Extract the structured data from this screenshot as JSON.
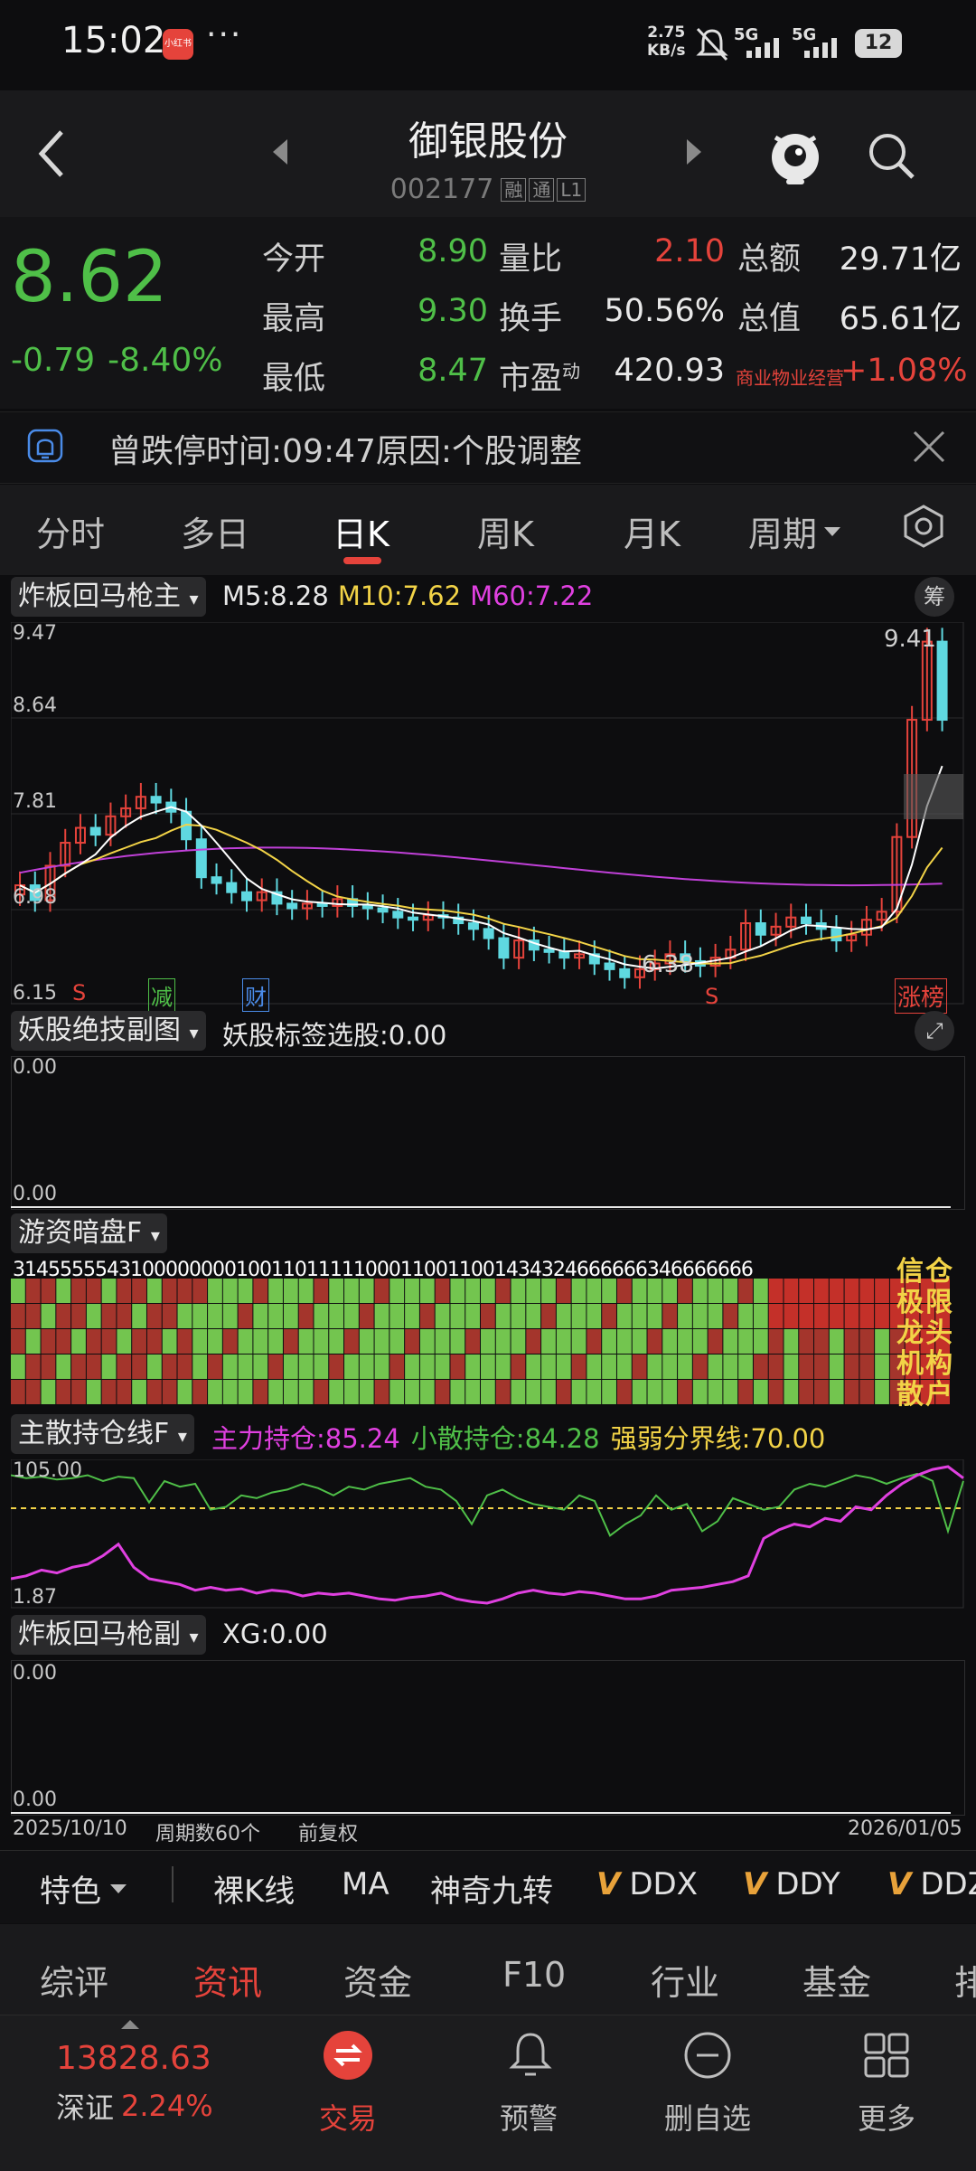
{
  "status": {
    "time": "15:02",
    "app_badge": "小红书",
    "dots": "···",
    "net_speed_value": "2.75",
    "net_speed_unit": "KB/s",
    "sig1": "5G",
    "sig2": "5G",
    "battery": "12"
  },
  "header": {
    "name": "御银股份",
    "code": "002177",
    "tags": [
      "融",
      "通",
      "L1"
    ]
  },
  "quote": {
    "price": "8.62",
    "change": "-0.79",
    "change_pct": "-8.40%",
    "rows": [
      {
        "l1": "今开",
        "v1": "8.90",
        "l2": "量比",
        "v2": "2.10",
        "l3": "总额",
        "v3": "29.71亿"
      },
      {
        "l1": "最高",
        "v1": "9.30",
        "l2": "换手",
        "v2": "50.56%",
        "l3": "总值",
        "v3": "65.61亿"
      },
      {
        "l1": "最低",
        "v1": "8.47",
        "l2": "市盈",
        "l2sup": "动",
        "v2": "420.93",
        "l3": "商业物业经营",
        "v3": "+1.08%"
      }
    ]
  },
  "notice": {
    "text": "曾跌停时间:09:47原因:个股调整"
  },
  "tabs": [
    "分时",
    "多日",
    "日K",
    "周K",
    "月K",
    "周期"
  ],
  "main_chart": {
    "selector": "炸板回马枪主",
    "m5": "M5:8.28",
    "m10": "M10:7.62",
    "m60": "M60:7.22",
    "chip_btn": "筹",
    "y_labels": [
      "9.47",
      "8.64",
      "7.81",
      "6.98",
      "6.15"
    ],
    "high_label": "9.41",
    "low_label": "6.38",
    "markers": [
      {
        "t": "S",
        "c": "#e5433b"
      },
      {
        "t": "减",
        "c": "#4fbf48"
      },
      {
        "t": "财",
        "c": "#4a8be8"
      },
      {
        "t": "S",
        "c": "#e5433b"
      },
      {
        "t": "涨榜",
        "c": "#e5433b"
      }
    ],
    "colors": {
      "up": "#e5433b",
      "down": "#5fd8e0",
      "m5": "#ffffff",
      "m10": "#f2d347",
      "m60": "#c040d8"
    }
  },
  "sub1": {
    "selector": "妖股绝技副图",
    "text": "妖股标签选股:0.00",
    "y_top": "0.00",
    "y_bottom": "0.00"
  },
  "sub2": {
    "selector": "游资暗盘F",
    "digits": "314555554310000000010011011111000110011001434324666666346666666",
    "side_text": "信极龙机散",
    "side_text2": "仓限头构户",
    "row_top": "3",
    "row_bottom": "1"
  },
  "sub3": {
    "selector": "主散持仓线F",
    "main": "主力持仓:85.24",
    "retail": "小散持仓:84.28",
    "line": "强弱分界线:70.00",
    "y_top": "105.00",
    "y_bottom": "1.87"
  },
  "sub4": {
    "selector": "炸板回马枪副",
    "text": "XG:0.00",
    "y_top": "0.00",
    "y_bottom": "0.00"
  },
  "footer": {
    "start": "2025/10/10",
    "count": "周期数60个",
    "adj": "前复权",
    "end": "2026/01/05"
  },
  "features": [
    "特色",
    "裸K线",
    "MA",
    "神奇九转",
    "DDX",
    "DDY",
    "DDZ"
  ],
  "info_tabs": [
    "综评",
    "资讯",
    "资金",
    "F10",
    "行业",
    "基金",
    "排"
  ],
  "nav": {
    "index_val": "13828.63",
    "index_name": "深证",
    "index_pct": "2.24%",
    "items": [
      "交易",
      "预警",
      "删自选",
      "更多"
    ]
  }
}
